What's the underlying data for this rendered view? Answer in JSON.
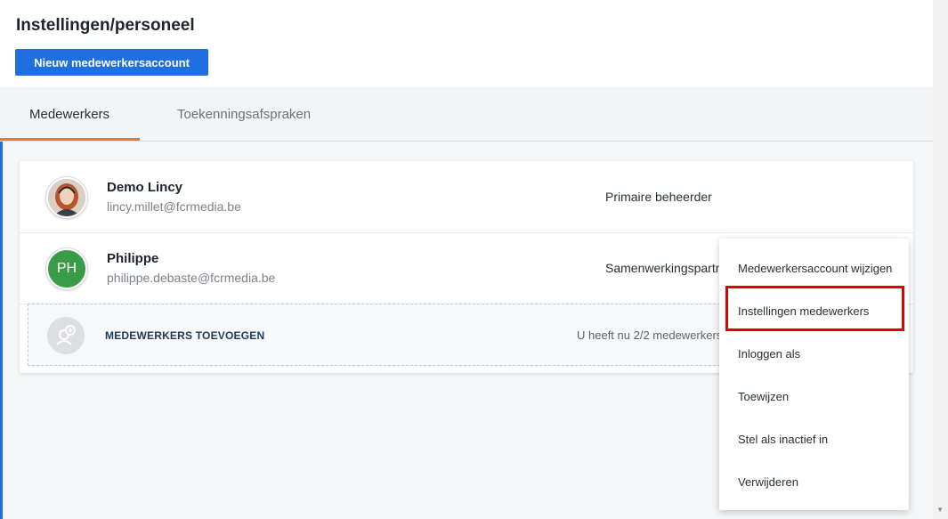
{
  "page": {
    "title": "Instellingen/personeel",
    "new_account_button": "Nieuw medewerkersaccount"
  },
  "tabs": [
    {
      "label": "Medewerkers",
      "active": true
    },
    {
      "label": "Toekenningsafspraken",
      "active": false
    }
  ],
  "employees": [
    {
      "name": "Demo Lincy",
      "email": "lincy.millet@fcrmedia.be",
      "role": "Primaire beheerder",
      "avatar": "photo"
    },
    {
      "name": "Philippe",
      "email": "philippe.debaste@fcrmedia.be",
      "role": "Samenwerkingspartner",
      "avatar": "PH"
    }
  ],
  "add_row": {
    "label": "MEDEWERKERS TOEVOEGEN",
    "count_text": "U heeft nu 2/2 medewerkers"
  },
  "context_menu": {
    "items": [
      "Medewerkersaccount wijzigen",
      "Instellingen medewerkers",
      "Inloggen als",
      "Toewijzen",
      "Stel als inactief in",
      "Verwijderen"
    ],
    "highlighted_index": 1
  },
  "colors": {
    "primary": "#1f6fe0",
    "tab_accent": "#e8772e",
    "avatar_green": "#3a9b48",
    "highlight": "#e00000"
  }
}
